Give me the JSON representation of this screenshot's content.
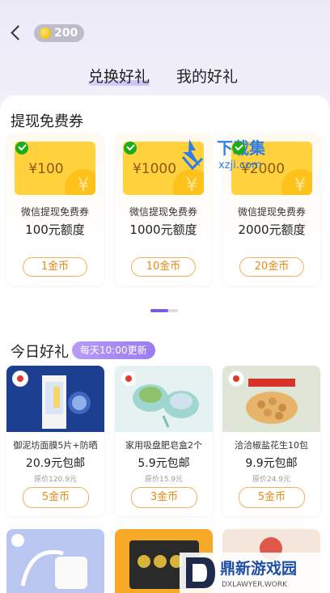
{
  "header": {
    "coins": "200"
  },
  "tabs": [
    {
      "label": "兑换好礼",
      "active": true
    },
    {
      "label": "我的好礼",
      "active": false
    }
  ],
  "vouchers_section": {
    "title": "提现免费券",
    "items": [
      {
        "amount": "¥100",
        "name": "微信提现免费券",
        "quota": "100元额度",
        "price": "1金币"
      },
      {
        "amount": "¥1000",
        "name": "微信提现免费券",
        "quota": "1000元额度",
        "price": "10金币"
      },
      {
        "amount": "¥2000",
        "name": "微信提现免费券",
        "quota": "2000元额度",
        "price": "20金币"
      }
    ]
  },
  "daily_section": {
    "title": "今日好礼",
    "badge": "每天10:00更新",
    "items": [
      {
        "name": "御泥坊面膜5片+防晒",
        "price": "20.9元包邮",
        "original": "原价120.9元",
        "cost": "5金币"
      },
      {
        "name": "家用吸盘肥皂盒2个",
        "price": "5.9元包邮",
        "original": "原价15.9元",
        "cost": "3金币"
      },
      {
        "name": "洽洽椒盐花生10包",
        "price": "9.9元包邮",
        "original": "原价24.9元",
        "cost": "5金币"
      }
    ]
  },
  "watermarks": {
    "top_cn": "下载集",
    "top_en": "xzji.com",
    "bottom_cn": "鼎新游戏园",
    "bottom_en": "DXLAWYER.WORK"
  },
  "colors": {
    "accent": "#7a5be0",
    "coin_orange": "#e68a13",
    "ticket_yellow": "#ffd23e",
    "wechat_green": "#1aad19"
  }
}
